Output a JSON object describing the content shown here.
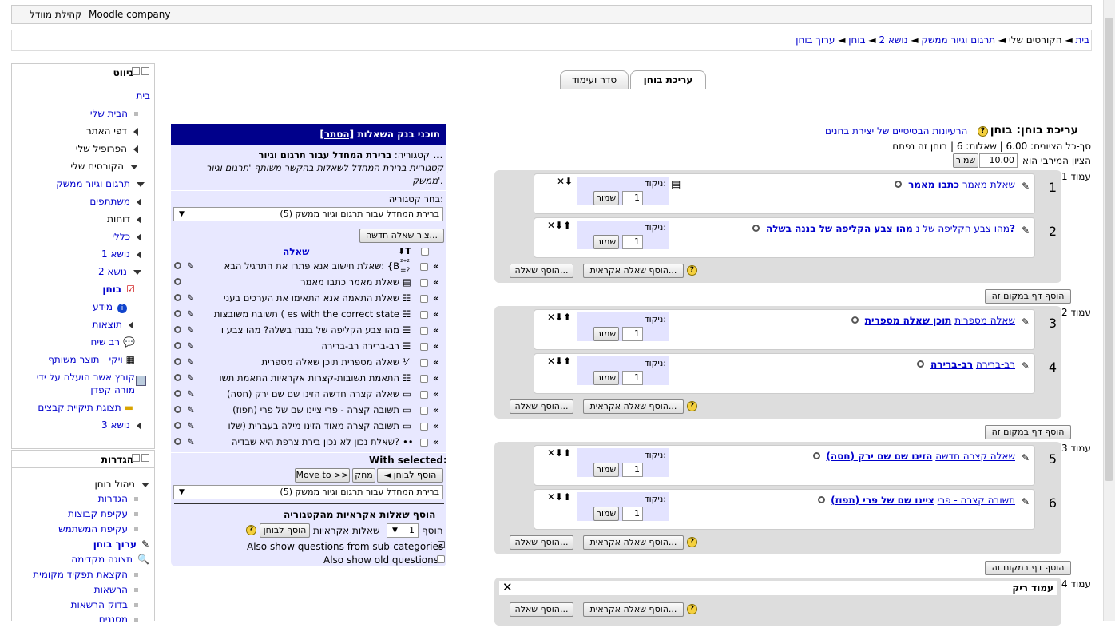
{
  "header": {
    "site_name": "Moodle company",
    "community": "קהילת מוודל"
  },
  "breadcrumb": [
    "בית",
    "הקורסים שלי",
    "תרגום וגיור ממשק",
    "נושא 2",
    "בוחן",
    "ערוך בוחן"
  ],
  "tabs": {
    "edit": "עריכת בוחן",
    "order": "סדר ועימוד"
  },
  "nav_block": {
    "title": "ניווט",
    "items": [
      "בית",
      "הבית שלי",
      "דפי האתר",
      "הפרופיל שלי",
      "הקורסים שלי",
      "תרגום וגיור ממשק",
      "משתתפים",
      "דוחות",
      "כללי",
      "נושא 1",
      "נושא 2",
      "בוחן",
      "מידע",
      "תוצאות",
      "רב שיח",
      "ויקי - תוצר משותף",
      "קובץ אשר הועלה על ידי מורה קפדן",
      "תצוגת תיקיית קבצים",
      "נושא 3"
    ]
  },
  "settings_block": {
    "title": "הגדרות",
    "items": [
      "ניהול בוחן",
      "הגדרות",
      "עקיפת קבוצות",
      "עקיפת המשתמש",
      "ערוך בוחן",
      "תצוגה מקדימה",
      "הקצאת תפקיד מקומית",
      "הרשאות",
      "בדוק הרשאות",
      "מסננים"
    ]
  },
  "quiz": {
    "title": "עריכת בוחן: בוחן",
    "help_link": "הרעיונות הבסיסיים של יצירת בחנים",
    "summary": "סך-כל הציונים: 6.00 | שאלות: 6 | בוחן זה נפתח",
    "max_grade_label": "הציון המירבי הוא",
    "max_grade_value": "10.00",
    "save": "שמור",
    "grade_label": "ניקוד:",
    "grade_value": "1",
    "add_question": "הוסף שאלה...",
    "add_random": "הוסף שאלה אקראית...",
    "add_page": "הוסף דף במקום זה",
    "empty_page": "עמוד ריק",
    "pages": [
      {
        "label": "עמוד 1",
        "questions": [
          {
            "num": "1",
            "type": "שאלת מאמר",
            "name": "כתבו מאמר",
            "arrows": "✕⬇"
          },
          {
            "num": "2",
            "type": "מהו צבע הקליפה של נ",
            "name": "מהו צבע הקליפה של בננה בשלה?",
            "arrows": "✕⬇⬆"
          }
        ]
      },
      {
        "label": "עמוד 2",
        "questions": [
          {
            "num": "3",
            "type": "שאלה מספרית",
            "name": "תוכן שאלה מספרית",
            "arrows": "✕⬇⬆"
          },
          {
            "num": "4",
            "type": "רב-ברירה",
            "name": "רב-ברירה",
            "arrows": "✕⬇⬆"
          }
        ]
      },
      {
        "label": "עמוד 3",
        "questions": [
          {
            "num": "5",
            "type": "שאלה קצרה חדשה",
            "name": "הזינו שם שם ירק (חסה)",
            "arrows": "✕⬇⬆"
          },
          {
            "num": "6",
            "type": "תשובה קצרה - פרי",
            "name": "ציינו שם של פרי (תפוז)",
            "arrows": "✕⬇⬆"
          }
        ]
      },
      {
        "label": "עמוד 4",
        "questions": []
      }
    ]
  },
  "bank": {
    "title": "תוכני בנק השאלות",
    "hide": "[הסתר]",
    "category_label": "קטגוריה:",
    "category_name": "ברירת המחדל עבור תרגום וגיור ...",
    "category_desc": "קטגוריית ברירת המחדל לשאלות בהקשר משותף 'תרגום וגיור ממשק'.",
    "choose_category": "בחר קטגוריה:",
    "category_select": "ברירת המחדל עבור תרגום וגיור ממשק (5)",
    "create_new": "צור שאלה חדשה...",
    "col_t": "T",
    "col_question": "שאלה",
    "rows": [
      "שאלת חישוב אנא פתרו את התרגיל הבא: {B",
      "שאלת מאמר כתבו מאמר",
      "שאלת התאמה אנא התאימו את הערכים בעני",
      "תשובת משובצות ( es with the correct state",
      "מהו צבע הקליפה של בננה בשלה? מהו צבע ו",
      "רב-ברירה רב-ברירה",
      "שאלה מספרית תוכן שאלה מספרית",
      "התאמת תשובות-קצרות אקראיות התאמת תשו",
      "שאלה קצרה חדשה הזינו שם שם ירק (חסה)",
      "תשובה קצרה - פרי ציינו שם של פרי (תפוז)",
      "תשובה קצרה מאוד הזינו מילה בעברית (שלו",
      "שאלת נכון לא נכון בירת צרפת היא שבדיה?"
    ],
    "with_selected": "With selected:",
    "add_to_quiz": "◄ הוסף לבוחן",
    "delete": "מחק",
    "move_to": "Move to >>",
    "random_title": "הוסף שאלות אקראיות מהקטגוריה",
    "add": "הוסף",
    "random_count": "1",
    "random_questions": "שאלות אקראיות",
    "add_to_quiz2": "הוסף לבוחן",
    "show_subcats": "Also show questions from sub-categories",
    "show_old": "Also show old questions"
  }
}
